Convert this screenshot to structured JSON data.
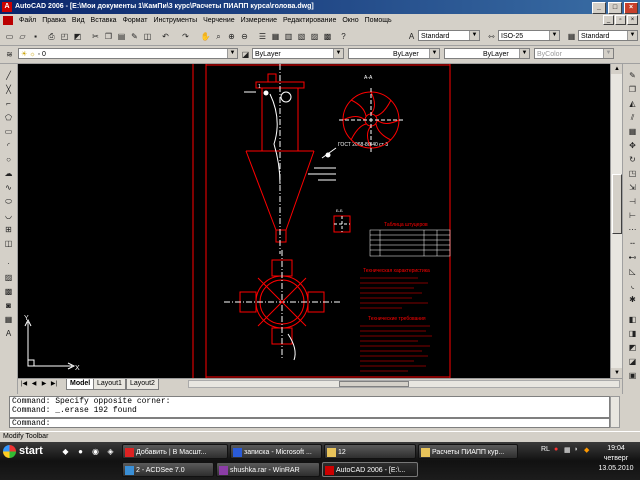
{
  "window": {
    "title": "AutoCAD 2006 - [E:\\Мои документы 1\\КамПи\\3 курс\\Расчеты ПИАПП курса\\голова.dwg]",
    "app_icon": "autocad-icon"
  },
  "menu": {
    "items": [
      "Файл",
      "Правка",
      "Вид",
      "Вставка",
      "Формат",
      "Инструменты",
      "Черчение",
      "Измерение",
      "Редактирование",
      "Окно",
      "Помощь"
    ]
  },
  "toolbar": {
    "text_style": "Standard",
    "dim_style": "ISO-25",
    "table_style": "Standard",
    "layer": "0",
    "color": "ByLayer",
    "linetype": "ByLayer",
    "lineweight": "ByLayer",
    "plot_style": "ByColor"
  },
  "drawing": {
    "section_label": "А-А",
    "cross_label": "Б-Б",
    "callout_text": "ГОСТ 2068-80-40 ст 3",
    "tech_title": "Техническая характеристика",
    "tech_req_title": "Технические требования",
    "spec_title": "Таблица штуцеров",
    "colors": {
      "background": "#000000",
      "primary": "#ff0000",
      "secondary": "#ffffff",
      "border": "#ff0000"
    }
  },
  "layout_tabs": {
    "items": [
      "Model",
      "Layout1",
      "Layout2"
    ],
    "active": "Model"
  },
  "command": {
    "history": [
      "Command: Specify opposite corner:",
      "Command: _.erase 192 found"
    ],
    "prompt": "Command:"
  },
  "status": {
    "text": "Modify Toolbar"
  },
  "taskbar": {
    "start_label": "start",
    "tasks_row1": [
      "Добавить | В Масшт...",
      "записка - Microsoft ...",
      "12",
      "Расчеты ПИАПП кур..."
    ],
    "tasks_row2": [
      "2 - ACDSee 7.0",
      "shushka.rar - WinRAR",
      "AutoCAD 2006 - [E:\\..."
    ],
    "active_task": "AutoCAD 2006 - [E:\\...",
    "language": "RL",
    "clock": {
      "time": "19:04",
      "day": "четверг",
      "date": "13.05.2010"
    }
  }
}
